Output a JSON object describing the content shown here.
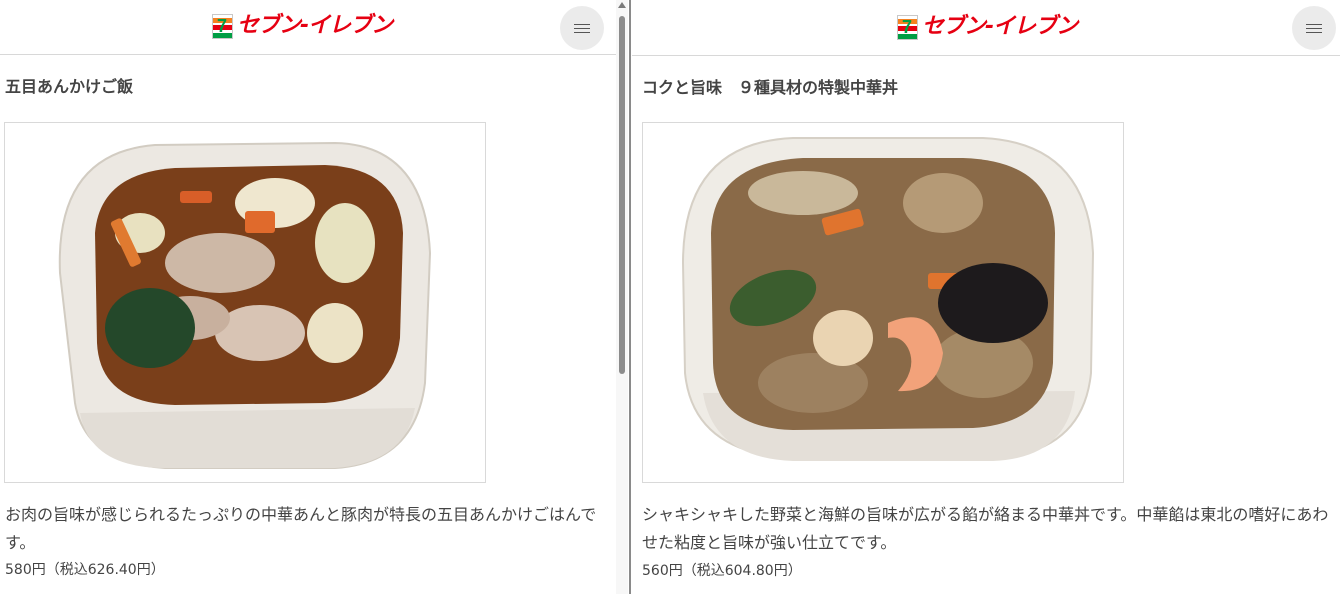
{
  "brand": {
    "logo_text": "セブン-イレブン",
    "logo_mark_text": "7",
    "colors": {
      "orange": "#f58220",
      "red": "#e60012",
      "green": "#009e44"
    }
  },
  "menu_button": {
    "icon": "hamburger-icon"
  },
  "products": [
    {
      "title": "五目あんかけご飯",
      "image_icon": "food-bowl-photo",
      "description": "お肉の旨味が感じられるたっぷりの中華あんと豚肉が特長の五目あんかけごはんです。",
      "price": "580円（税込626.40円）"
    },
    {
      "title": "コクと旨味　９種具材の特製中華丼",
      "image_icon": "food-bowl-photo",
      "description": "シャキシャキした野菜と海鮮の旨味が広がる餡が絡まる中華丼です。中華餡は東北の嗜好にあわせた粘度と旨味が強い仕立てです。",
      "price": "560円（税込604.80円）"
    }
  ]
}
